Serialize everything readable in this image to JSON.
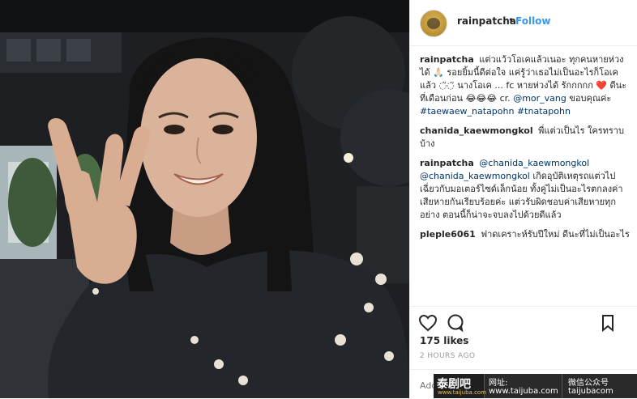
{
  "post": {
    "username": "rainpatcha",
    "dot": "•",
    "follow_label": "Follow"
  },
  "comments": [
    {
      "user": "rainpatcha",
      "text": "แต่วแว้วโอเคแล้วเนอะ ทุกคนหายห่วงได้ 🙏🏻 รอยยิ้มนี้ดีต่อใจ แค่รู้ว่าเธอไม่เป็นอะไรก็โอเคแล้ว ◌̈◌̈ นางโอเค ... fc หายห่วงได้ รักกกกก ❤️ ดีนะที่เดือนก่อน 😂😂😂 cr.",
      "tag1": "@mor_vang",
      "text2": "ขอบคุณค่ะ",
      "tag2": "#taewaew_natapohn",
      "tag3": "#tnatapohn"
    },
    {
      "user": "chanida_kaewmongkol",
      "text": "พี่แต่วเป็นไร ใครทราบบ้าง"
    },
    {
      "user": "rainpatcha",
      "tag1": "@chanida_kaewmongkol",
      "tag2": "@chanida_kaewmongkol",
      "text": "เกิดอุบัติเหตุรถแต่วไปเฉี่ยวกับมอเตอร์ไซด์เล็กน้อย ทั้งคู่ไม่เป็นอะไรตกลงค่าเสียหายกันเรียบร้อยค่ะ แต่วรับผิดชอบค่าเสียหายทุกอย่าง ตอนนี้ก็น่าจะจบลงไปด้วยดีแล้ว"
    },
    {
      "user": "pleple6061",
      "text": "ฟาดเคราะห์รับปีใหม่ ดีนะที่ไม่เป็นอะไร"
    }
  ],
  "likes": "175 likes",
  "time": "2 HOURS AGO",
  "add_comment_placeholder": "Add a comment...",
  "watermark": {
    "logo_big": "泰剧吧",
    "logo_small": "www.taijuba.com",
    "site_label": "网址:",
    "site_url": "www.taijuba.com",
    "wechat_label": "微信公众号",
    "wechat_id": "taijubacom"
  }
}
